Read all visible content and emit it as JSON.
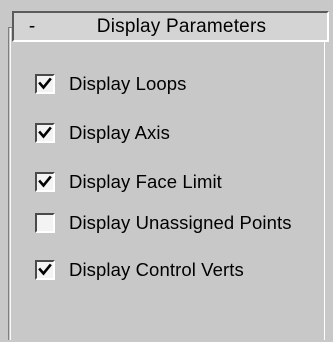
{
  "rollout": {
    "toggle_symbol": "-",
    "title": "Display Parameters"
  },
  "options": [
    {
      "label": "Display Loops",
      "checked": true
    },
    {
      "label": "Display Axis",
      "checked": true
    },
    {
      "label": "Display Face Limit",
      "checked": true
    },
    {
      "label": "Display Unassigned Points",
      "checked": false
    },
    {
      "label": "Display Control Verts",
      "checked": true
    }
  ],
  "icons": {
    "checkmark": "checkmark-icon"
  }
}
